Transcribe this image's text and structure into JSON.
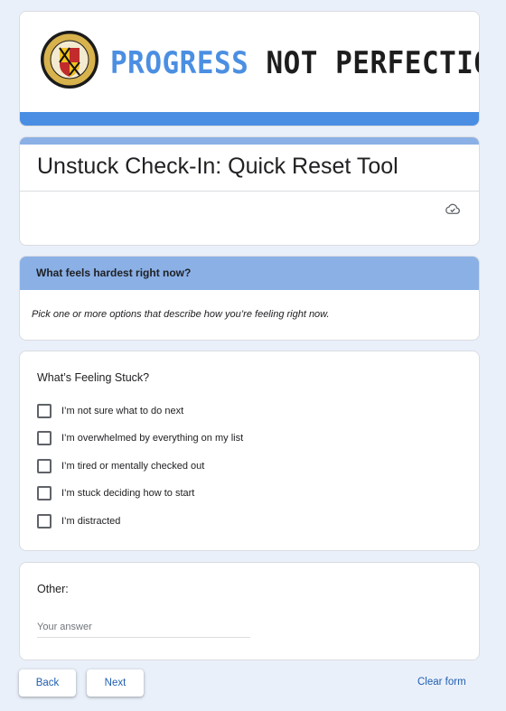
{
  "banner": {
    "word1": "PROGRESS",
    "word2": "NOT PERFECTION",
    "seal_text": "ANNE ARUNDEL COUNTY OFFICE OF EMERGENCY MANAGEMENT & CONTINUITY"
  },
  "form": {
    "title": "Unstuck Check-In: Quick Reset Tool"
  },
  "section": {
    "title": "What feels hardest right now?",
    "description": "Pick one or more options that describe how you’re feeling right now."
  },
  "question": {
    "title": "What’s Feeling Stuck?",
    "options": [
      {
        "label": "I’m not sure what to do next",
        "checked": false
      },
      {
        "label": "I’m overwhelmed by everything on my list",
        "checked": false
      },
      {
        "label": "I’m tired or mentally checked out",
        "checked": false
      },
      {
        "label": "I’m stuck deciding how to start",
        "checked": false
      },
      {
        "label": "I’m distracted",
        "checked": false
      }
    ]
  },
  "other": {
    "title": "Other:",
    "placeholder": "Your answer",
    "value": ""
  },
  "nav": {
    "back_label": "Back",
    "next_label": "Next",
    "clear_label": "Clear form"
  },
  "colors": {
    "accent": "#4a8ee3",
    "section_header": "#8ab0e6",
    "background": "#eaf0fa"
  }
}
